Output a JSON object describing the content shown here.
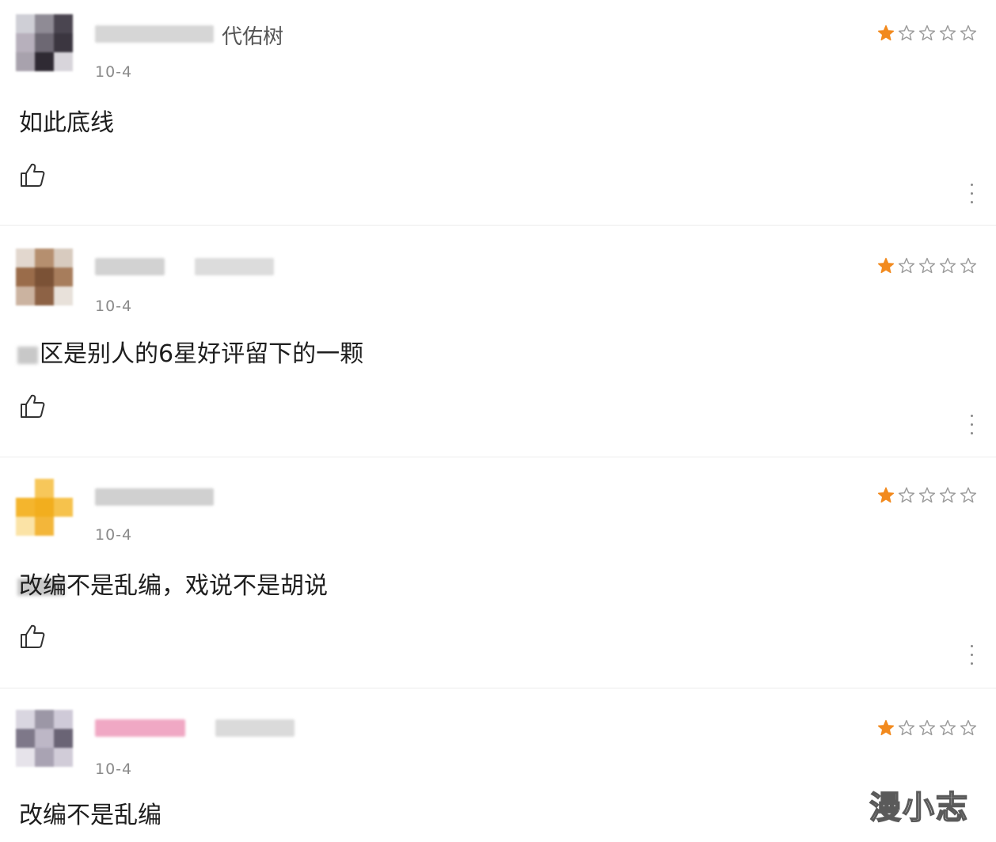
{
  "reviews": [
    {
      "username": "代佑树",
      "date": "10-4",
      "content": "如此底线",
      "content_prefix_obscured": false,
      "rating": 1,
      "rating_max": 5,
      "avatar_colors": [
        "#cfcfd6",
        "#8f8b95",
        "#4a4550",
        "#b7b0bc",
        "#6d6873",
        "#3b3640",
        "#a8a2ad",
        "#2f2a33",
        "#d8d5db"
      ],
      "name_blur_color": "#d0d0d0"
    },
    {
      "username": "",
      "date": "10-4",
      "content": "区是别人的6星好评留下的一颗",
      "content_prefix_obscured": true,
      "rating": 1,
      "rating_max": 5,
      "avatar_colors": [
        "#e2d7ce",
        "#b58f6f",
        "#d8cbbf",
        "#9a6c4a",
        "#7b5236",
        "#a77d5c",
        "#cbb3a0",
        "#8d6245",
        "#e8e1da"
      ],
      "name_blur_color": "#cfcfcf"
    },
    {
      "username": "",
      "date": "10-4",
      "content": "改编不是乱编，戏说不是胡说",
      "content_prefix_obscured": true,
      "rating": 1,
      "rating_max": 5,
      "avatar_colors": [
        "#ffffff",
        "#f7c75a",
        "#ffffff",
        "#f4b52d",
        "#f2ae1e",
        "#f6c24c",
        "#fbe3a6",
        "#f3b63a",
        "#ffffff"
      ],
      "name_blur_color": "#cccccc"
    },
    {
      "username": "",
      "date": "10-4",
      "content": "改编不是乱编",
      "content_prefix_obscured": false,
      "rating": 1,
      "rating_max": 5,
      "avatar_colors": [
        "#d9d6e0",
        "#9c97a6",
        "#cfcad8",
        "#7e7889",
        "#bdb7c6",
        "#6a6475",
        "#e6e3ea",
        "#a9a3b3",
        "#d1ccd8"
      ],
      "name_blur_color": "#f2a8c4"
    }
  ],
  "icons": {
    "like": "thumbs-up-icon",
    "more": "more-vertical-icon",
    "star_filled": "star-filled-icon",
    "star_empty": "star-outline-icon"
  },
  "colors": {
    "star_filled": "#f28a1e",
    "star_empty": "#9a9a9a"
  },
  "watermark": "漫小志"
}
